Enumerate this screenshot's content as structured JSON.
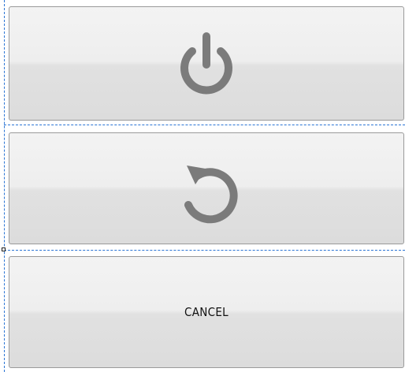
{
  "buttons": {
    "power": {
      "icon": "power-icon"
    },
    "reboot": {
      "icon": "restart-icon"
    },
    "cancel": {
      "label": "CANCEL"
    }
  },
  "colors": {
    "icon": "#7b7b7b",
    "border": "#9a9a9a",
    "guide": "#2a74d4"
  }
}
